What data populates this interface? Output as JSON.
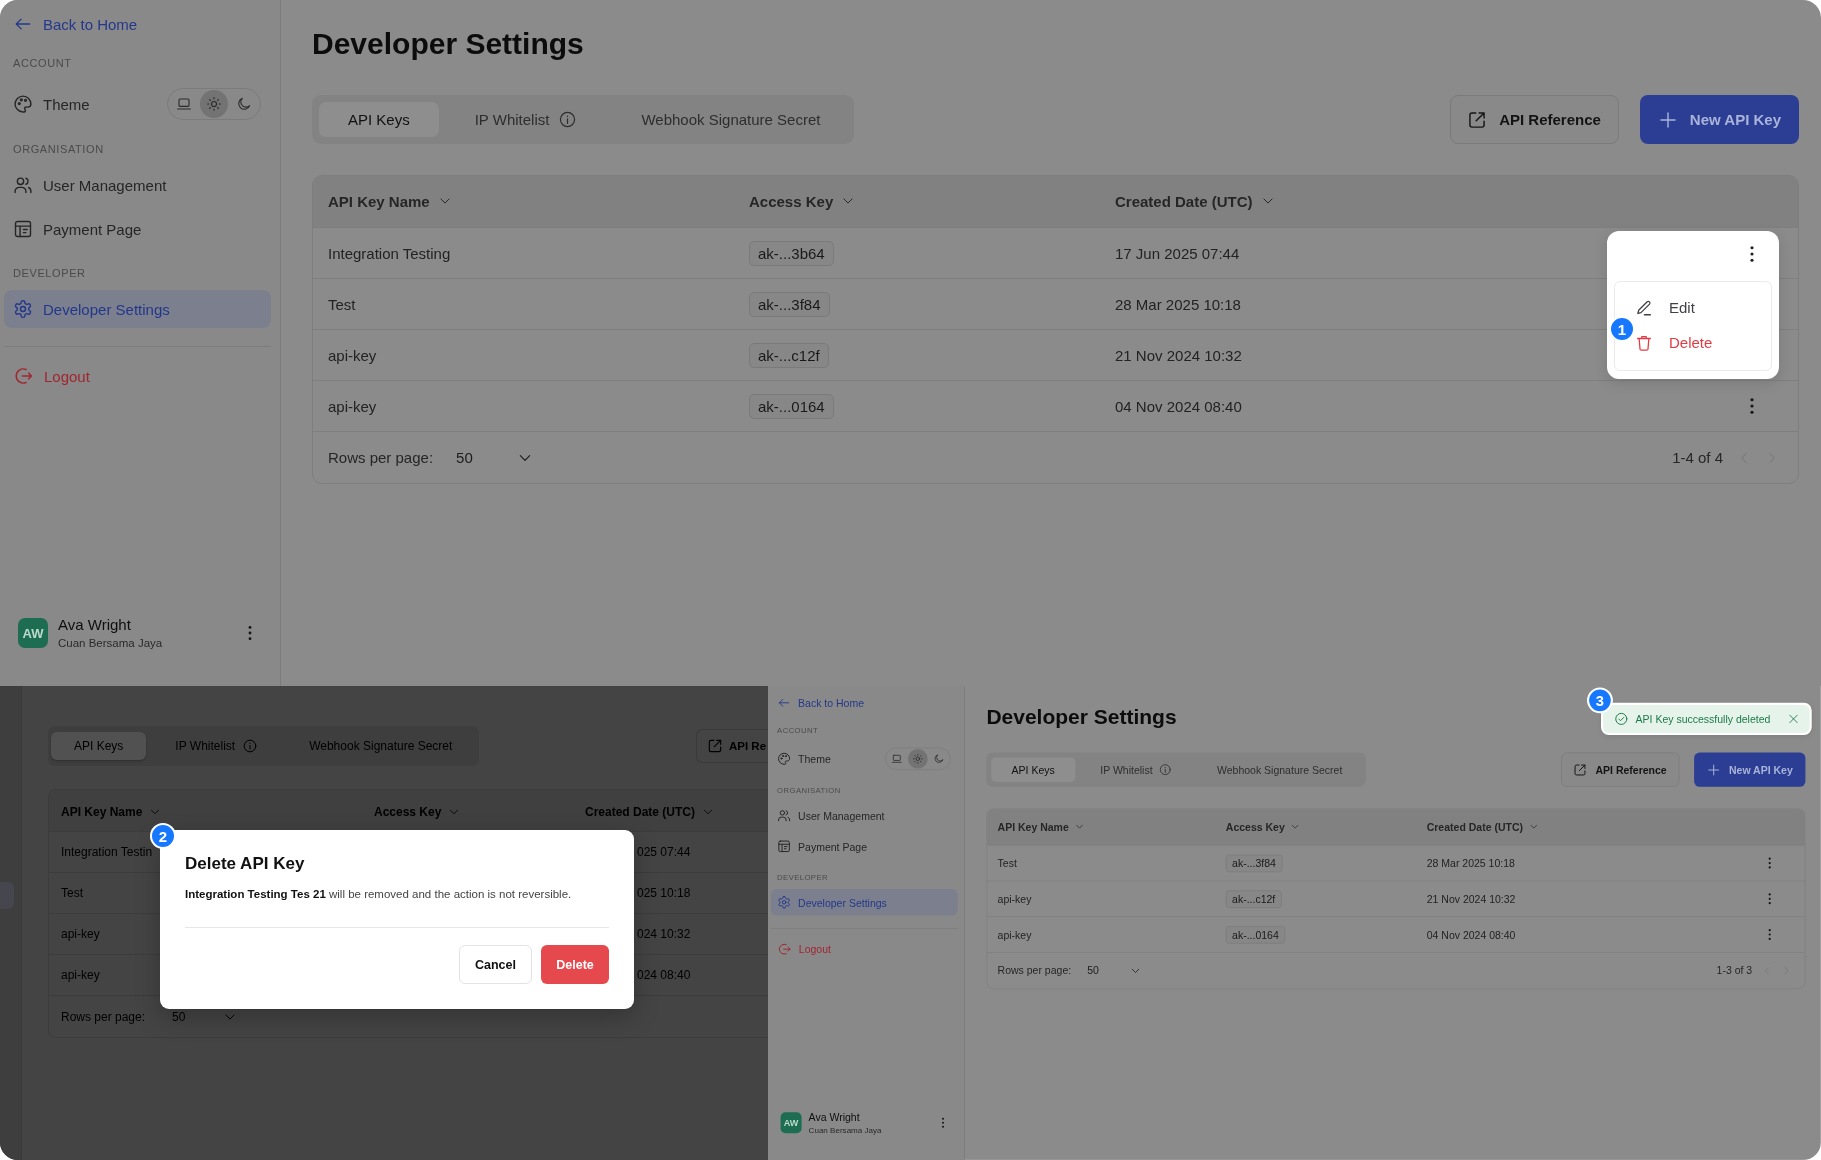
{
  "overview_screen": {
    "sidebar": {
      "back_link": "Back to Home",
      "sections": [
        {
          "heading": "ACCOUNT",
          "items": [
            {
              "kind": "theme",
              "label": "Theme",
              "theme_modes": [
                {
                  "kind": "system",
                  "selected": false
                },
                {
                  "kind": "light",
                  "selected": true
                },
                {
                  "kind": "dark",
                  "selected": false
                }
              ]
            }
          ]
        },
        {
          "heading": "ORGANISATION",
          "items": [
            {
              "kind": "users",
              "label": "User Management",
              "selected": false
            },
            {
              "kind": "payment",
              "label": "Payment Page",
              "selected": false
            }
          ]
        },
        {
          "heading": "DEVELOPER",
          "items": [
            {
              "kind": "settings",
              "label": "Developer Settings",
              "selected": true
            }
          ]
        }
      ],
      "logout": "Logout",
      "user": {
        "initials": "AW",
        "name": "Ava Wright",
        "organisation": "Cuan Bersama Jaya"
      }
    },
    "title": "Developer Settings",
    "tabs": [
      {
        "label": "API Keys",
        "selected": true,
        "has_info": false
      },
      {
        "label": "IP Whitelist",
        "selected": false,
        "has_info": true
      },
      {
        "label": "Webhook Signature Secret",
        "selected": false,
        "has_info": false
      }
    ],
    "actions": [
      {
        "kind": "reference",
        "label": "API Reference"
      },
      {
        "kind": "create",
        "label": "New API Key"
      }
    ],
    "table": {
      "columns": [
        "API Key Name",
        "Access Key",
        "Created Date (UTC)"
      ],
      "rows": [
        {
          "name": "Integration Testing",
          "access_key": "ak-...3b64",
          "created": "17 Jun 2025 07:44",
          "menu_open": true
        },
        {
          "name": "Test",
          "access_key": "ak-...3f84",
          "created": "28 Mar 2025 10:18",
          "menu_open": false
        },
        {
          "name": "api-key",
          "access_key": "ak-...c12f",
          "created": "21 Nov 2024 10:32",
          "menu_open": false
        },
        {
          "name": "api-key",
          "access_key": "ak-...0164",
          "created": "04 Nov 2024 08:40",
          "menu_open": false
        }
      ],
      "footer": {
        "rows_per_page_label": "Rows per page:",
        "rows_per_page": "50",
        "range": "1-4 of 4",
        "previous_disabled": true,
        "next_disabled": true
      }
    },
    "row_menu": {
      "step": "1",
      "items": [
        {
          "kind": "edit",
          "label": "Edit"
        },
        {
          "kind": "delete",
          "label": "Delete"
        }
      ]
    }
  },
  "confirm_screen": {
    "tabs": [
      {
        "label": "API Keys",
        "selected": true,
        "has_info": false
      },
      {
        "label": "IP Whitelist",
        "selected": false,
        "has_info": true
      },
      {
        "label": "Webhook Signature Secret",
        "selected": false,
        "has_info": false
      }
    ],
    "action": {
      "label": "API Re"
    },
    "columns": [
      "API Key Name",
      "Access Key",
      "Created Date (UTC)"
    ],
    "rows": [
      {
        "name": "Integration Testin",
        "created": "025 07:44"
      },
      {
        "name": "Test",
        "created": "025 10:18"
      },
      {
        "name": "api-key",
        "created": "024 10:32"
      },
      {
        "name": "api-key",
        "created": "024 08:40"
      }
    ],
    "rows_per_page_label": "Rows per page:",
    "rows_per_page": "50",
    "dialog": {
      "step": "2",
      "title": "Delete API Key",
      "message": "**Integration Testing Tes 21** will be removed and the action is not reversible.",
      "buttons": [
        {
          "kind": "cancel",
          "label": "Cancel"
        },
        {
          "kind": "danger",
          "label": "Delete"
        }
      ]
    }
  },
  "result_screen": {
    "sidebar": {
      "back_link": "Back to Home",
      "sections": [
        {
          "heading": "ACCOUNT",
          "items": [
            {
              "kind": "theme",
              "label": "Theme",
              "theme_modes": [
                {
                  "kind": "system",
                  "selected": false
                },
                {
                  "kind": "light",
                  "selected": true
                },
                {
                  "kind": "dark",
                  "selected": false
                }
              ]
            }
          ]
        },
        {
          "heading": "ORGANISATION",
          "items": [
            {
              "kind": "users",
              "label": "User Management",
              "selected": false
            },
            {
              "kind": "payment",
              "label": "Payment Page",
              "selected": false
            }
          ]
        },
        {
          "heading": "DEVELOPER",
          "items": [
            {
              "kind": "settings",
              "label": "Developer Settings",
              "selected": true
            }
          ]
        }
      ],
      "logout": "Logout",
      "user": {
        "initials": "AW",
        "name": "Ava Wright",
        "organisation": "Cuan Bersama Jaya"
      }
    },
    "title": "Developer Settings",
    "toast": {
      "step": "3",
      "message": "API Key successfully deleted"
    },
    "tabs": [
      {
        "label": "API Keys",
        "selected": true,
        "has_info": false
      },
      {
        "label": "IP Whitelist",
        "selected": false,
        "has_info": true
      },
      {
        "label": "Webhook Signature Secret",
        "selected": false,
        "has_info": false
      }
    ],
    "actions": [
      {
        "kind": "reference",
        "label": "API Reference"
      },
      {
        "kind": "create",
        "label": "New API Key"
      }
    ],
    "table": {
      "columns": [
        "API Key Name",
        "Access Key",
        "Created Date (UTC)"
      ],
      "rows": [
        {
          "name": "Test",
          "access_key": "ak-...3f84",
          "created": "28 Mar 2025 10:18",
          "menu_open": false
        },
        {
          "name": "api-key",
          "access_key": "ak-...c12f",
          "created": "21 Nov 2024 10:32",
          "menu_open": false
        },
        {
          "name": "api-key",
          "access_key": "ak-...0164",
          "created": "04 Nov 2024 08:40",
          "menu_open": false
        }
      ],
      "footer": {
        "rows_per_page_label": "Rows per page:",
        "rows_per_page": "50",
        "range": "1-3 of 3",
        "previous_disabled": true,
        "next_disabled": true
      }
    }
  }
}
